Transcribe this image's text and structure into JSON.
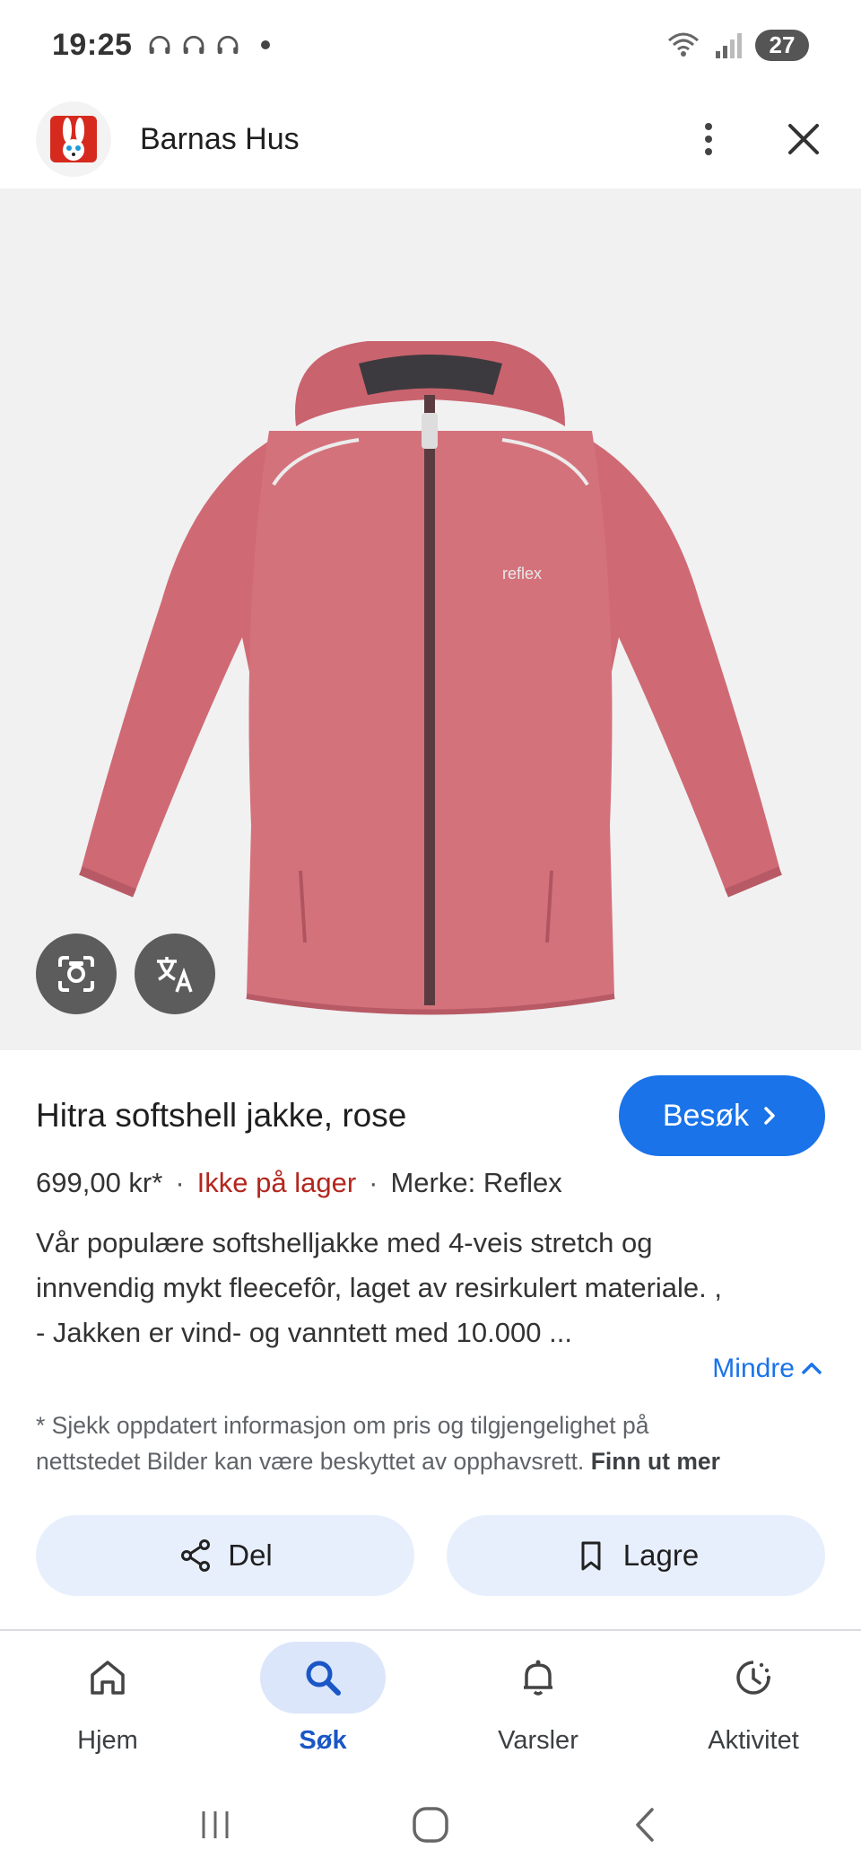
{
  "status_bar": {
    "time": "19:25",
    "battery": "27"
  },
  "header": {
    "site_name": "Barnas Hus"
  },
  "product": {
    "title": "Hitra softshell jakke, rose",
    "visit_label": "Besøk",
    "price": "699,00 kr*",
    "stock": "Ikke på lager",
    "brand": "Merke: Reflex",
    "description_lines": [
      "Vår populære softshelljakke med 4-veis stretch og",
      "innvendig mykt fleecefôr, laget av resirkulert materiale. ,",
      "- Jakken er vind- og vanntett med 10.000 ..."
    ],
    "less_label": "Mindre",
    "disclaimer_lines": [
      "* Sjekk oppdatert informasjon om pris og tilgjengelighet på",
      "nettstedet Bilder kan være beskyttet av opphavsrett."
    ],
    "learn_more": "Finn ut mer",
    "image_logo_text": "reflex"
  },
  "actions": {
    "share_label": "Del",
    "save_label": "Lagre"
  },
  "bottom_nav": {
    "items": [
      {
        "label": "Hjem",
        "icon": "home-icon"
      },
      {
        "label": "Søk",
        "icon": "search-icon",
        "active": true
      },
      {
        "label": "Varsler",
        "icon": "bell-icon"
      },
      {
        "label": "Aktivitet",
        "icon": "activity-icon"
      }
    ]
  },
  "colors": {
    "accent": "#1a73e8",
    "stock_red": "#b3261e",
    "jacket": "#d4707a",
    "pill_bg": "#e7effd"
  }
}
